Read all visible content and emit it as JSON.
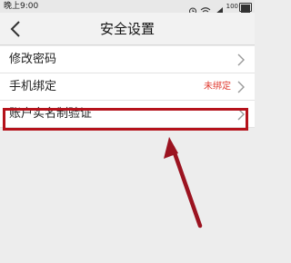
{
  "status_bar": {
    "time": "晚上9:00",
    "battery_percent": 100,
    "icons": [
      "alarm-icon",
      "wifi-icon",
      "signal-icon",
      "battery-icon"
    ]
  },
  "nav": {
    "title": "安全设置",
    "back_icon": "chevron-left-icon"
  },
  "settings": {
    "items": [
      {
        "label": "修改密码",
        "value": ""
      },
      {
        "label": "手机绑定",
        "value": "未绑定"
      },
      {
        "label": "账户实名制验证",
        "value": ""
      }
    ]
  },
  "colors": {
    "accent_red": "#e03a2f",
    "highlight": "#b5121b",
    "annotation_arrow": "#9b1320"
  }
}
